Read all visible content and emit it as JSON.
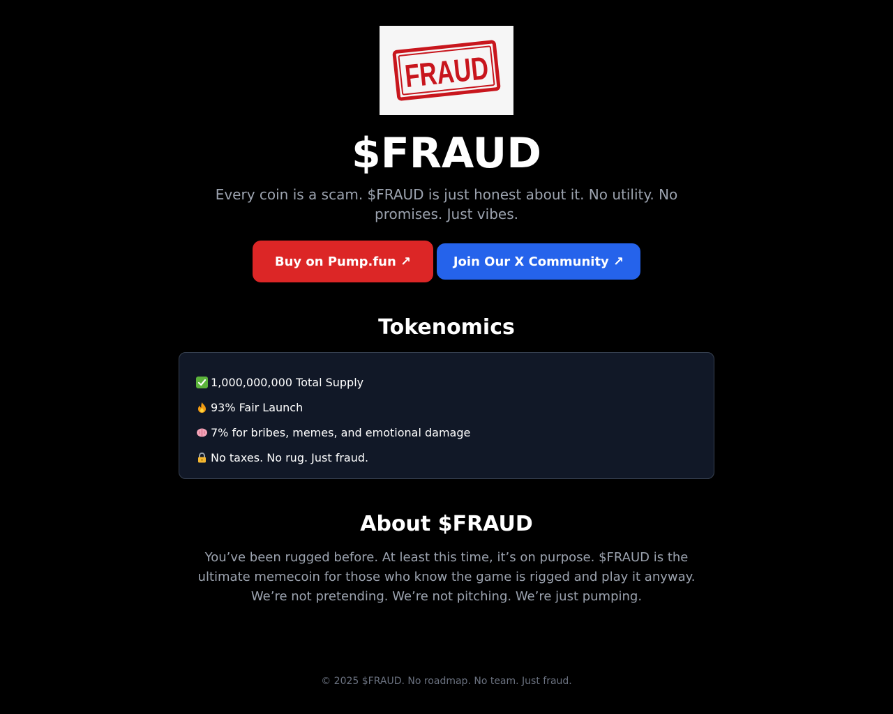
{
  "logo": {
    "stamp_text": "FRAUD",
    "stamp_color": "#c8161d"
  },
  "hero": {
    "title": "$FRAUD",
    "tagline": "Every coin is a scam. $FRAUD is just honest about it. No utility. No promises. Just vibes."
  },
  "buttons": {
    "buy_label": "Buy on Pump.fun ↗",
    "x_label": "Join Our X Community ↗"
  },
  "tokenomics": {
    "heading": "Tokenomics",
    "items": [
      {
        "icon": "check-mark-icon",
        "text": "1,000,000,000 Total Supply"
      },
      {
        "icon": "fire-icon",
        "text": "93% Fair Launch"
      },
      {
        "icon": "brain-icon",
        "text": "7% for bribes, memes, and emotional damage"
      },
      {
        "icon": "lock-icon",
        "text": "No taxes. No rug. Just fraud."
      }
    ]
  },
  "about": {
    "heading": "About $FRAUD",
    "text": "You’ve been rugged before. At least this time, it’s on purpose. $FRAUD is the ultimate memecoin for those who know the game is rigged and play it anyway. We’re not pretending. We’re not pitching. We’re just pumping."
  },
  "footer": {
    "text": "© 2025 $FRAUD. No roadmap. No team. Just fraud."
  },
  "colors": {
    "background": "#000000",
    "buy_button": "#dc2626",
    "x_button": "#2563eb",
    "card_background": "#111827",
    "muted_text": "#9ca3af"
  }
}
